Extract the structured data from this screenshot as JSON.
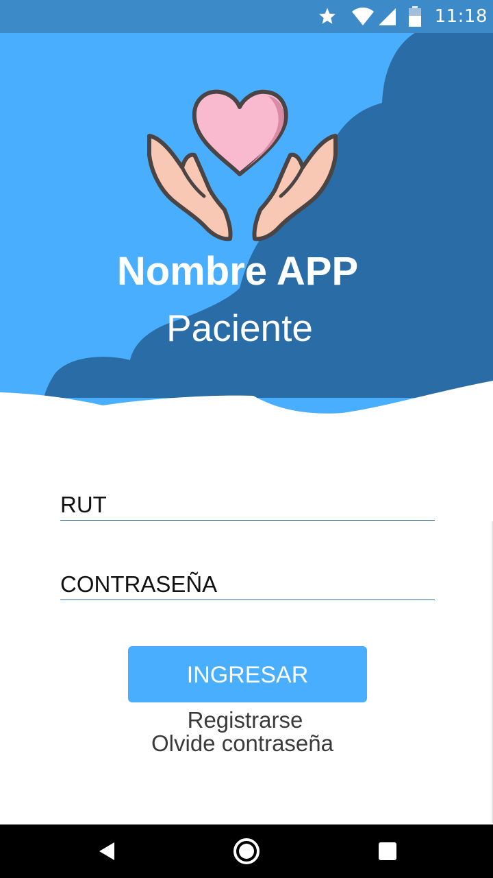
{
  "status_bar": {
    "time": "11:18",
    "icons": [
      "star-icon",
      "wifi-icon",
      "signal-icon",
      "battery-icon"
    ]
  },
  "header": {
    "app_name": "Nombre APP",
    "subtitle": "Paciente",
    "logo": "heart-hands-icon"
  },
  "form": {
    "rut_placeholder": "RUT",
    "password_placeholder": "CONTRASEÑA",
    "login_button": "INGRESAR",
    "register_link": "Registrarse",
    "forgot_link": "Olvide contraseña"
  },
  "nav_bar": {
    "icons": [
      "back-icon",
      "home-icon",
      "recent-apps-icon"
    ]
  },
  "colors": {
    "sky_light": "#4aaeff",
    "sky_dark": "#2a6ca5",
    "status_bar": "#3d8ac9",
    "button": "#4aaeff",
    "heart": "#f9b9cf",
    "hands": "#f9c8b4"
  }
}
